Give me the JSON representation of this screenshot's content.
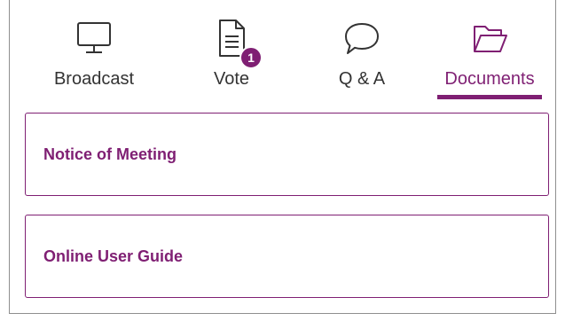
{
  "tabs": [
    {
      "label": "Broadcast",
      "icon": "monitor-icon",
      "active": false
    },
    {
      "label": "Vote",
      "icon": "document-icon",
      "active": false,
      "badge": "1"
    },
    {
      "label": "Q & A",
      "icon": "speech-bubble-icon",
      "active": false
    },
    {
      "label": "Documents",
      "icon": "folder-open-icon",
      "active": true
    }
  ],
  "documents": [
    {
      "title": "Notice of Meeting"
    },
    {
      "title": "Online User Guide"
    }
  ],
  "colors": {
    "accent": "#7f1f73",
    "text": "#333333",
    "border": "#8e8e8e",
    "background": "#ffffff"
  }
}
